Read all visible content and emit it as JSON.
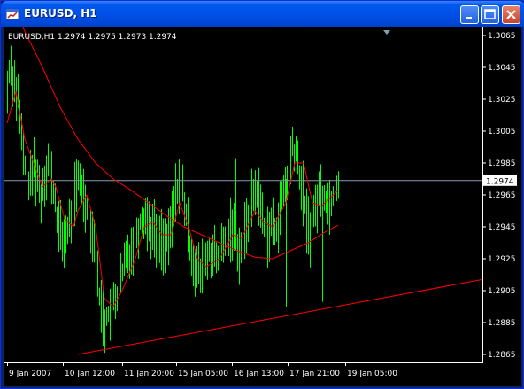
{
  "window": {
    "title": "EURUSD, H1"
  },
  "chart_info": "EURUSD,H1  1.2974 1.2975 1.2973 1.2974",
  "current_price_label": "1.2974",
  "colors": {
    "background": "#000000",
    "candles": "#00ff00",
    "moving_average_fast": "#ff0000",
    "moving_average_slow": "#ff0000",
    "trendline": "#ff0000",
    "price_line": "#8a9cb4",
    "axis": "#ffffff"
  },
  "chart_data": {
    "type": "bar",
    "symbol": "EURUSD",
    "timeframe": "H1",
    "ohlc_header": {
      "open": 1.2974,
      "high": 1.2975,
      "low": 1.2973,
      "close": 1.2974
    },
    "y_ticks": [
      "1.3065",
      "1.3045",
      "1.3025",
      "1.3005",
      "1.2985",
      "1.2965",
      "1.2945",
      "1.2925",
      "1.2905",
      "1.2885",
      "1.2865"
    ],
    "ylim": [
      1.286,
      1.307
    ],
    "x_ticks": [
      "9 Jan 2007",
      "10 Jan 12:00",
      "11 Jan 20:00",
      "15 Jan 05:00",
      "16 Jan 13:00",
      "17 Jan 21:00",
      "19 Jan 05:00"
    ],
    "current_price": 1.2974,
    "close_path": [
      [
        0,
        1.303
      ],
      [
        3,
        1.305
      ],
      [
        6,
        1.304
      ],
      [
        9,
        1.3032
      ],
      [
        12,
        1.3025
      ],
      [
        15,
        1.3005
      ],
      [
        18,
        1.299
      ],
      [
        22,
        1.2975
      ],
      [
        26,
        1.2972
      ],
      [
        30,
        1.2985
      ],
      [
        34,
        1.2975
      ],
      [
        38,
        1.2965
      ],
      [
        42,
        1.2978
      ],
      [
        46,
        1.2985
      ],
      [
        50,
        1.2975
      ],
      [
        54,
        1.296
      ],
      [
        58,
        1.2945
      ],
      [
        62,
        1.2936
      ],
      [
        66,
        1.294
      ],
      [
        70,
        1.2945
      ],
      [
        74,
        1.296
      ],
      [
        78,
        1.297
      ],
      [
        82,
        1.2975
      ],
      [
        86,
        1.2965
      ],
      [
        90,
        1.296
      ],
      [
        94,
        1.295
      ],
      [
        98,
        1.2935
      ],
      [
        102,
        1.291
      ],
      [
        106,
        1.2895
      ],
      [
        110,
        1.2885
      ],
      [
        114,
        1.289
      ],
      [
        118,
        1.2895
      ],
      [
        122,
        1.29
      ],
      [
        126,
        1.2905
      ],
      [
        130,
        1.2915
      ],
      [
        134,
        1.2925
      ],
      [
        138,
        1.293
      ],
      [
        142,
        1.2935
      ],
      [
        146,
        1.2942
      ],
      [
        150,
        1.2948
      ],
      [
        154,
        1.2952
      ],
      [
        158,
        1.295
      ],
      [
        162,
        1.2945
      ],
      [
        166,
        1.2942
      ],
      [
        170,
        1.294
      ],
      [
        174,
        1.2938
      ],
      [
        178,
        1.2935
      ],
      [
        182,
        1.2935
      ],
      [
        186,
        1.295
      ],
      [
        190,
        1.2965
      ],
      [
        194,
        1.2975
      ],
      [
        198,
        1.2968
      ],
      [
        202,
        1.295
      ],
      [
        206,
        1.2935
      ],
      [
        210,
        1.2925
      ],
      [
        214,
        1.2918
      ],
      [
        218,
        1.2915
      ],
      [
        222,
        1.292
      ],
      [
        226,
        1.2925
      ],
      [
        230,
        1.293
      ],
      [
        234,
        1.2926
      ],
      [
        238,
        1.2922
      ],
      [
        242,
        1.2928
      ],
      [
        246,
        1.2935
      ],
      [
        250,
        1.2942
      ],
      [
        254,
        1.2945
      ],
      [
        258,
        1.2938
      ],
      [
        262,
        1.293
      ],
      [
        266,
        1.2935
      ],
      [
        270,
        1.2945
      ],
      [
        274,
        1.2955
      ],
      [
        278,
        1.2965
      ],
      [
        282,
        1.2968
      ],
      [
        286,
        1.2958
      ],
      [
        290,
        1.2945
      ],
      [
        294,
        1.294
      ],
      [
        298,
        1.2945
      ],
      [
        302,
        1.2942
      ],
      [
        306,
        1.295
      ],
      [
        310,
        1.296
      ],
      [
        314,
        1.297
      ],
      [
        318,
        1.298
      ],
      [
        322,
        1.2995
      ],
      [
        326,
        1.299
      ],
      [
        330,
        1.2978
      ],
      [
        334,
        1.2965
      ],
      [
        338,
        1.295
      ],
      [
        342,
        1.294
      ],
      [
        346,
        1.295
      ],
      [
        350,
        1.2962
      ],
      [
        354,
        1.2968
      ],
      [
        358,
        1.2965
      ],
      [
        362,
        1.296
      ],
      [
        366,
        1.2962
      ],
      [
        370,
        1.2968
      ],
      [
        374,
        1.2974
      ]
    ],
    "ma_fast_path": [
      [
        0,
        1.301
      ],
      [
        10,
        1.303
      ],
      [
        20,
        1.3
      ],
      [
        30,
        1.2985
      ],
      [
        40,
        1.297
      ],
      [
        50,
        1.2975
      ],
      [
        55,
        1.297
      ],
      [
        65,
        1.295
      ],
      [
        75,
        1.2945
      ],
      [
        80,
        1.2955
      ],
      [
        90,
        1.2965
      ],
      [
        100,
        1.2945
      ],
      [
        110,
        1.29
      ],
      [
        120,
        1.2895
      ],
      [
        130,
        1.2905
      ],
      [
        145,
        1.2925
      ],
      [
        155,
        1.2945
      ],
      [
        165,
        1.2948
      ],
      [
        175,
        1.294
      ],
      [
        185,
        1.294
      ],
      [
        195,
        1.296
      ],
      [
        205,
        1.2945
      ],
      [
        215,
        1.2925
      ],
      [
        225,
        1.292
      ],
      [
        240,
        1.2925
      ],
      [
        255,
        1.294
      ],
      [
        265,
        1.2938
      ],
      [
        280,
        1.2955
      ],
      [
        290,
        1.2948
      ],
      [
        300,
        1.2945
      ],
      [
        315,
        1.296
      ],
      [
        325,
        1.2985
      ],
      [
        335,
        1.2985
      ],
      [
        345,
        1.296
      ],
      [
        355,
        1.2958
      ],
      [
        365,
        1.2963
      ],
      [
        374,
        1.2968
      ]
    ],
    "ma_slow_path": [
      [
        18,
        1.307
      ],
      [
        40,
        1.3045
      ],
      [
        60,
        1.302
      ],
      [
        80,
        1.3
      ],
      [
        100,
        1.2985
      ],
      [
        120,
        1.2975
      ],
      [
        140,
        1.2968
      ],
      [
        160,
        1.296
      ],
      [
        180,
        1.2952
      ],
      [
        200,
        1.2945
      ],
      [
        220,
        1.294
      ],
      [
        240,
        1.2935
      ],
      [
        260,
        1.293
      ],
      [
        280,
        1.2926
      ],
      [
        300,
        1.2925
      ],
      [
        320,
        1.293
      ],
      [
        340,
        1.2935
      ],
      [
        360,
        1.2942
      ],
      [
        374,
        1.2946
      ]
    ],
    "trendline": {
      "start": [
        80,
        1.2865
      ],
      "end": [
        540,
        1.2912
      ]
    }
  }
}
